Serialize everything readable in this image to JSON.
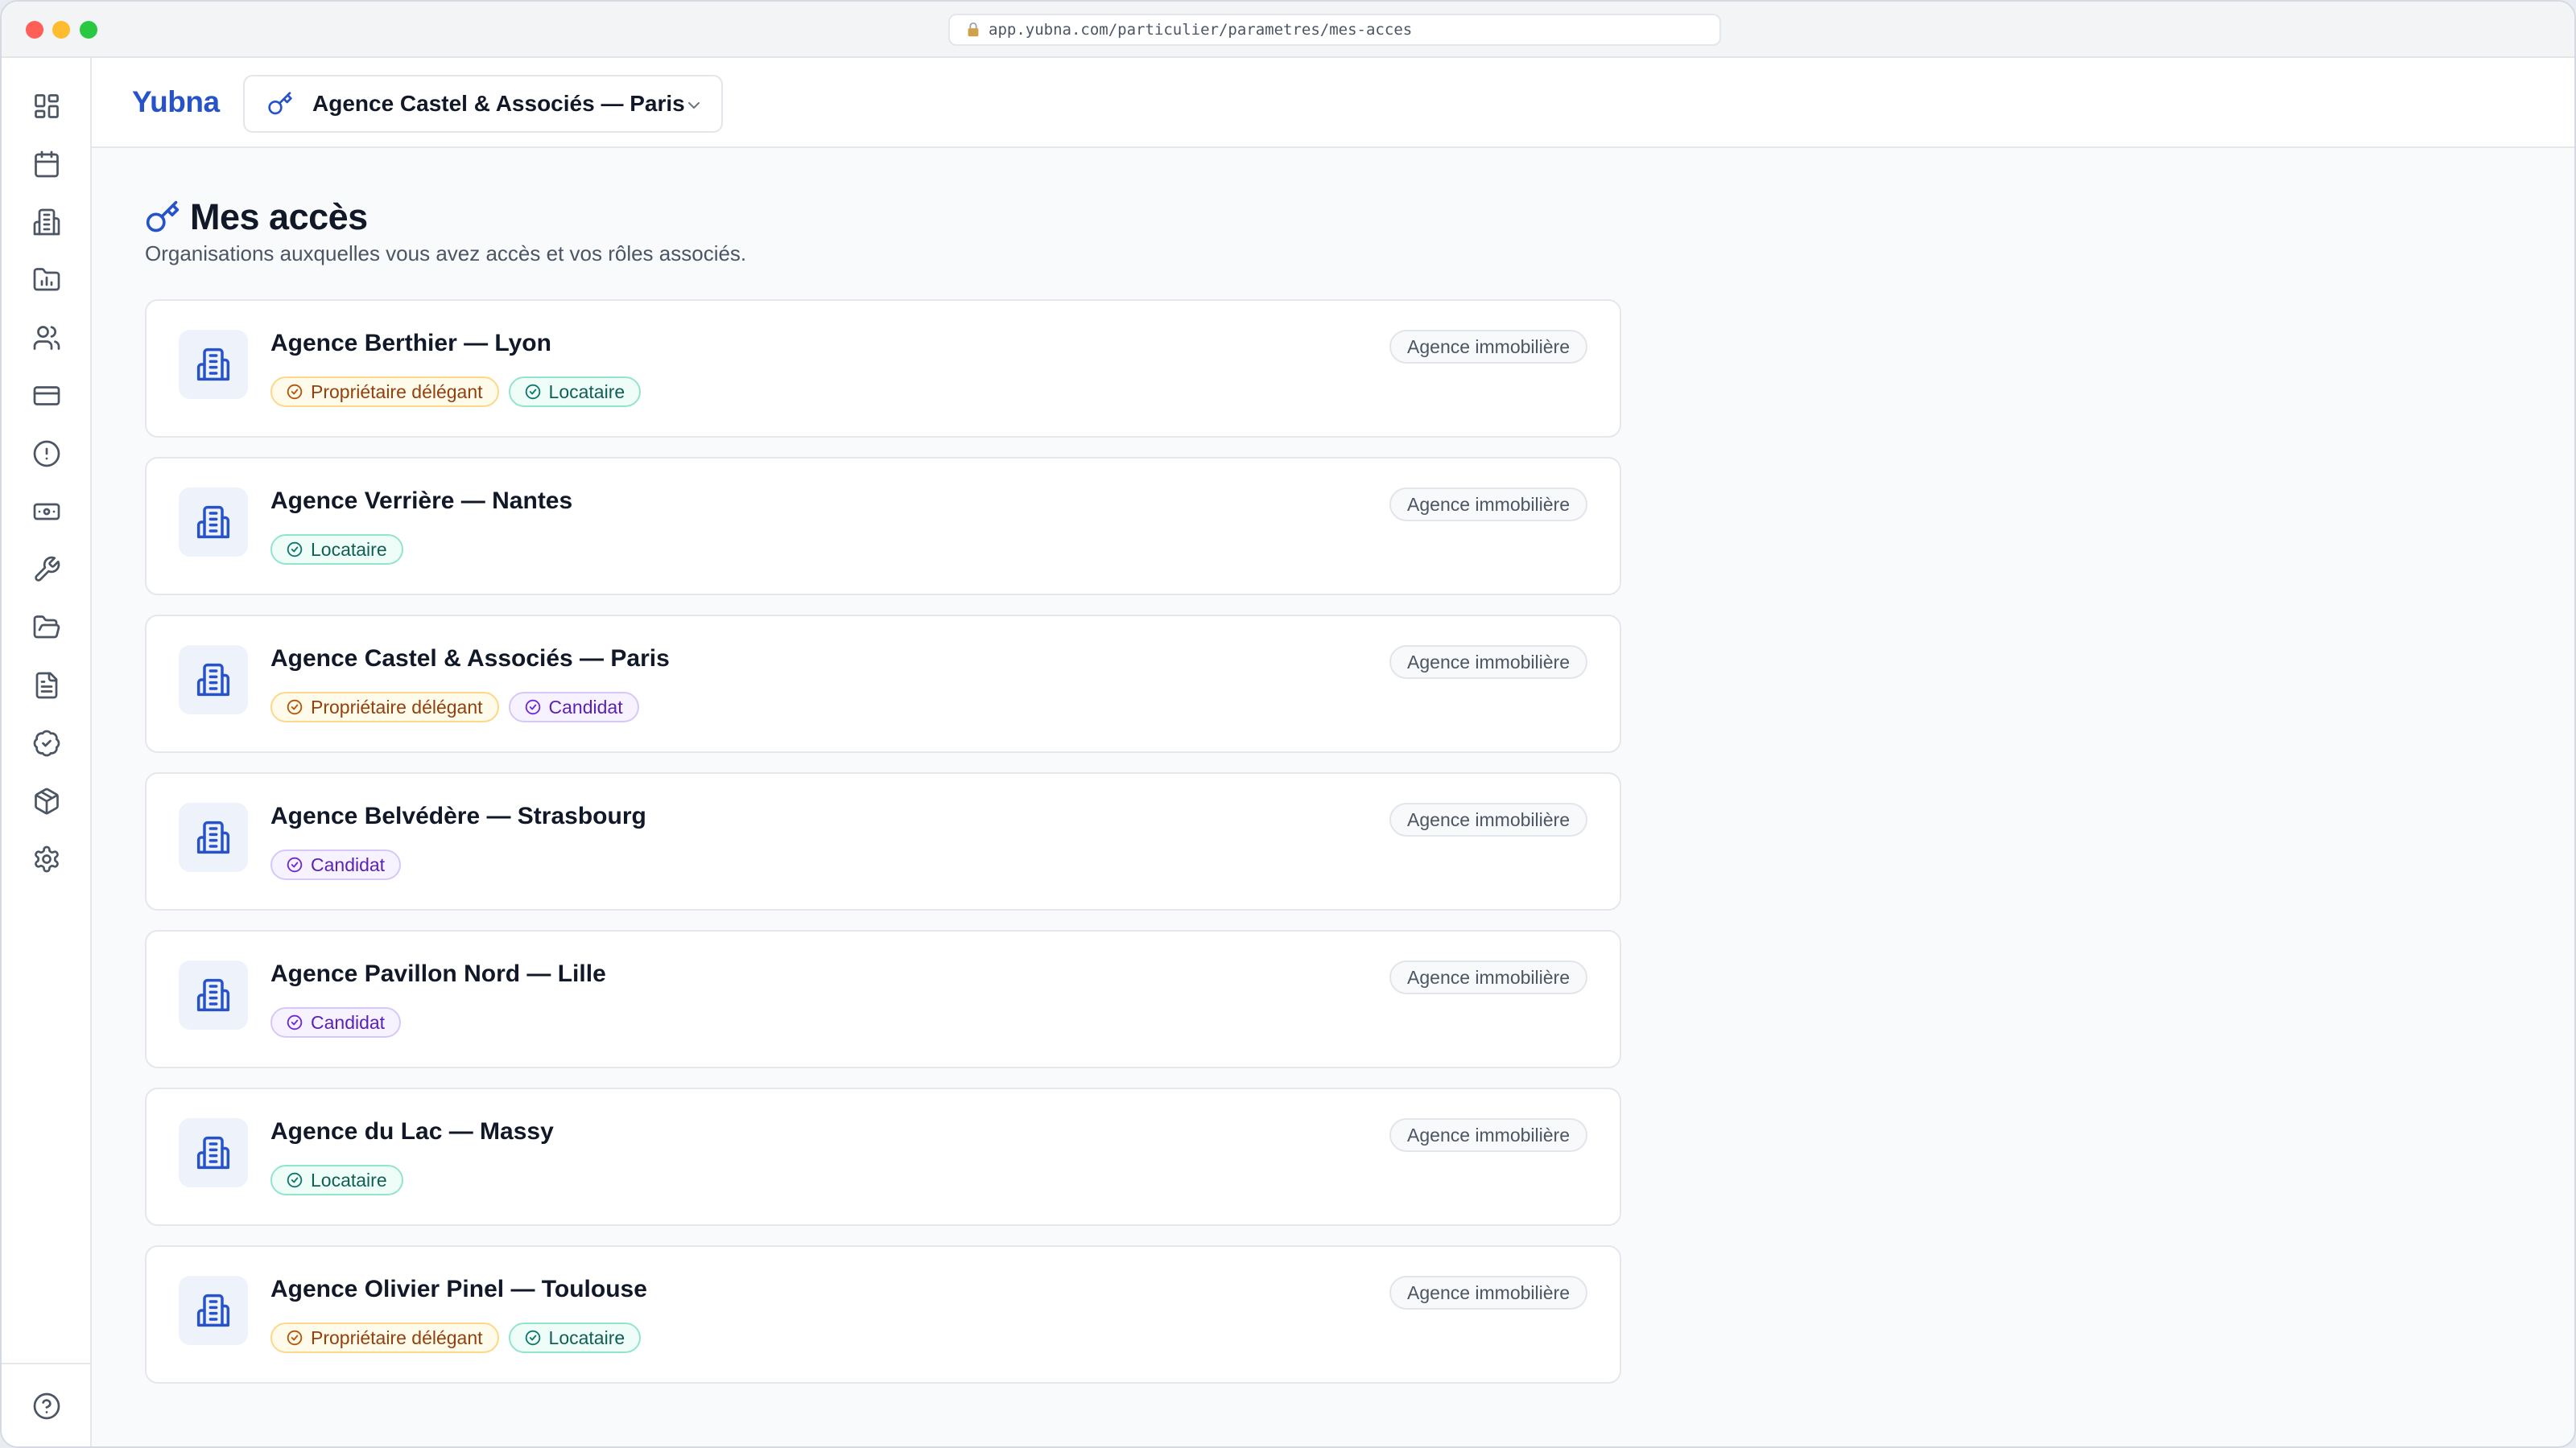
{
  "browser": {
    "url": "app.yubna.com/particulier/parametres/mes-acces"
  },
  "sidebar": {
    "items": [
      {
        "icon": "dashboard-grid-icon"
      },
      {
        "icon": "calendar-icon"
      },
      {
        "icon": "building-icon"
      },
      {
        "icon": "chart-folder-icon"
      },
      {
        "icon": "users-icon"
      },
      {
        "icon": "credit-card-icon"
      },
      {
        "icon": "alert-circle-icon"
      },
      {
        "icon": "banknote-icon"
      },
      {
        "icon": "wrench-icon"
      },
      {
        "icon": "folder-open-icon"
      },
      {
        "icon": "document-icon"
      },
      {
        "icon": "badge-check-icon"
      },
      {
        "icon": "package-icon"
      },
      {
        "icon": "settings-icon"
      }
    ],
    "footer_icon": "help-circle-icon"
  },
  "header": {
    "brand": "Yubna",
    "org_selector": {
      "icon": "key-icon",
      "label": "Agence Castel & Associés — Paris"
    }
  },
  "page": {
    "title": "Mes accès",
    "subtitle": "Organisations auxquelles vous avez accès et vos rôles associés."
  },
  "organizations": [
    {
      "name": "Agence Berthier — Lyon",
      "type": "Agence immobilière",
      "roles": [
        {
          "label": "Propriétaire délégant",
          "kind": "proprietaire"
        },
        {
          "label": "Locataire",
          "kind": "locataire"
        }
      ]
    },
    {
      "name": "Agence Verrière — Nantes",
      "type": "Agence immobilière",
      "roles": [
        {
          "label": "Locataire",
          "kind": "locataire"
        }
      ]
    },
    {
      "name": "Agence Castel & Associés — Paris",
      "type": "Agence immobilière",
      "roles": [
        {
          "label": "Propriétaire délégant",
          "kind": "proprietaire"
        },
        {
          "label": "Candidat",
          "kind": "candidat"
        }
      ]
    },
    {
      "name": "Agence Belvédère — Strasbourg",
      "type": "Agence immobilière",
      "roles": [
        {
          "label": "Candidat",
          "kind": "candidat"
        }
      ]
    },
    {
      "name": "Agence Pavillon Nord — Lille",
      "type": "Agence immobilière",
      "roles": [
        {
          "label": "Candidat",
          "kind": "candidat"
        }
      ]
    },
    {
      "name": "Agence du Lac — Massy",
      "type": "Agence immobilière",
      "roles": [
        {
          "label": "Locataire",
          "kind": "locataire"
        }
      ]
    },
    {
      "name": "Agence Olivier Pinel — Toulouse",
      "type": "Agence immobilière",
      "roles": [
        {
          "label": "Propriétaire délégant",
          "kind": "proprietaire"
        },
        {
          "label": "Locataire",
          "kind": "locataire"
        }
      ]
    }
  ],
  "colors": {
    "brand": "#2653c9",
    "proprietaire": "#b45309",
    "locataire": "#0f766e",
    "candidat": "#6d28d9"
  }
}
